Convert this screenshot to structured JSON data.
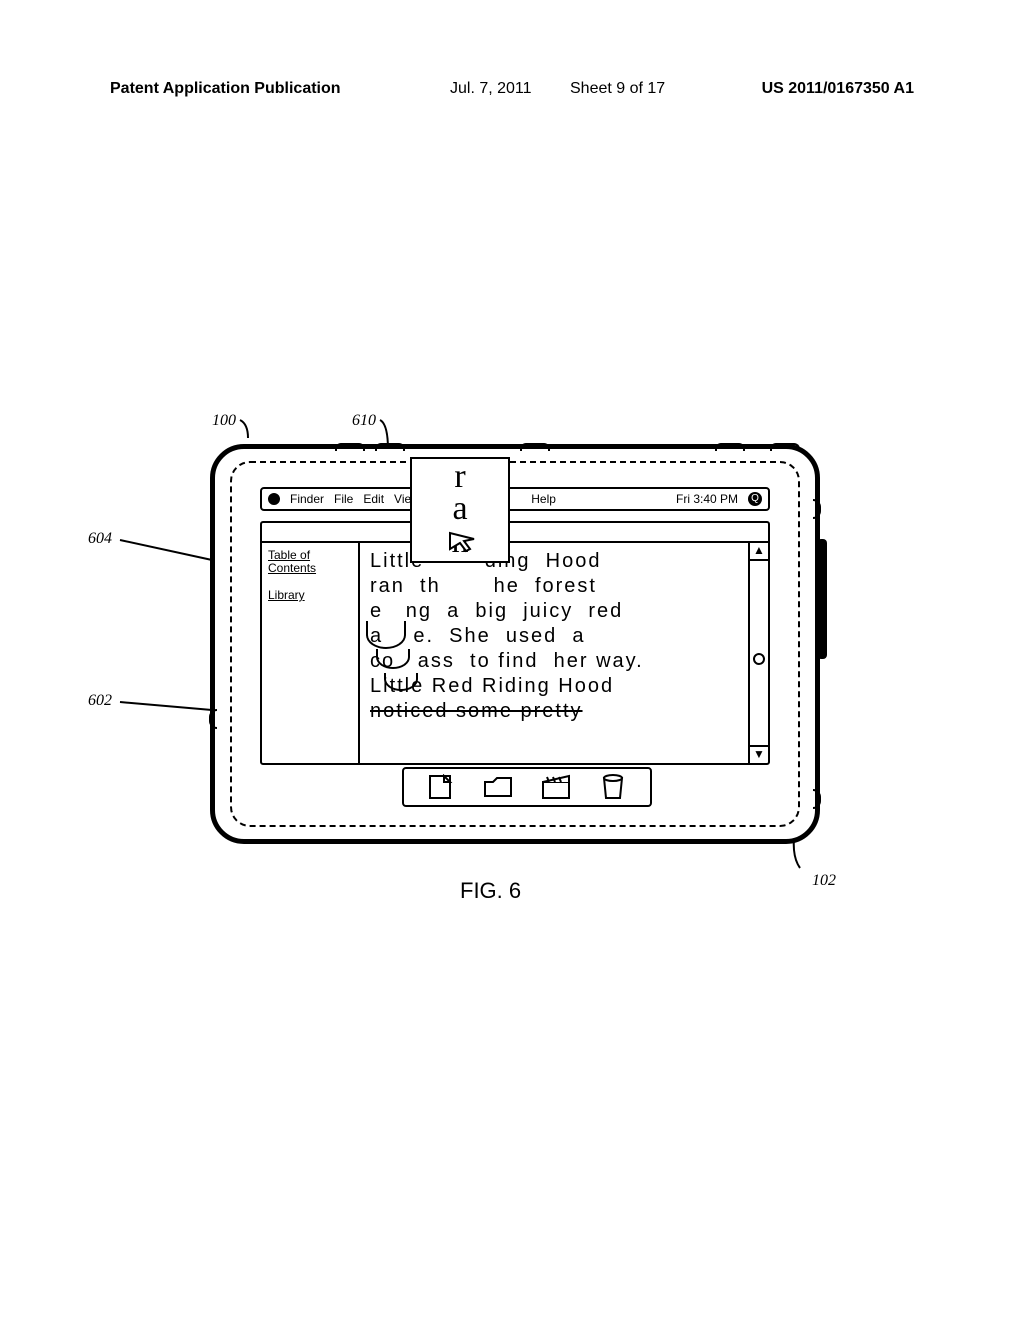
{
  "header": {
    "pub_label": "Patent Application Publication",
    "date": "Jul. 7, 2011",
    "sheet": "Sheet 9 of 17",
    "pub_number": "US 2011/0167350 A1"
  },
  "refs": {
    "r100": "100",
    "r610": "610",
    "r604": "604",
    "r602": "602",
    "r102": "102"
  },
  "figure_label": "FIG. 6",
  "menubar": {
    "items": [
      "Finder",
      "File",
      "Edit",
      "Vie"
    ],
    "help": "Help",
    "clock": "Fri 3:40 PM",
    "search_glyph": "Q"
  },
  "sidebar": {
    "toc": "Table of Contents",
    "library": "Library"
  },
  "content_lines": {
    "l0": "Little        ding  Hood",
    "l1": "ran  th       he  forest",
    "l2": "e   ng  a  big  juicy  red",
    "l3": "a    e.  She  used  a",
    "l4": "co   ass  to find  her way.",
    "l5": "Little Red Riding Hood",
    "l6": "noticed some pretty"
  },
  "cursor_letters": {
    "a": "r",
    "b": "a",
    "c": "n"
  },
  "scroll": {
    "up": "▲",
    "down": "▼"
  },
  "dock_icons": [
    "document-icon",
    "folder-icon",
    "clapper-icon",
    "trash-icon"
  ]
}
